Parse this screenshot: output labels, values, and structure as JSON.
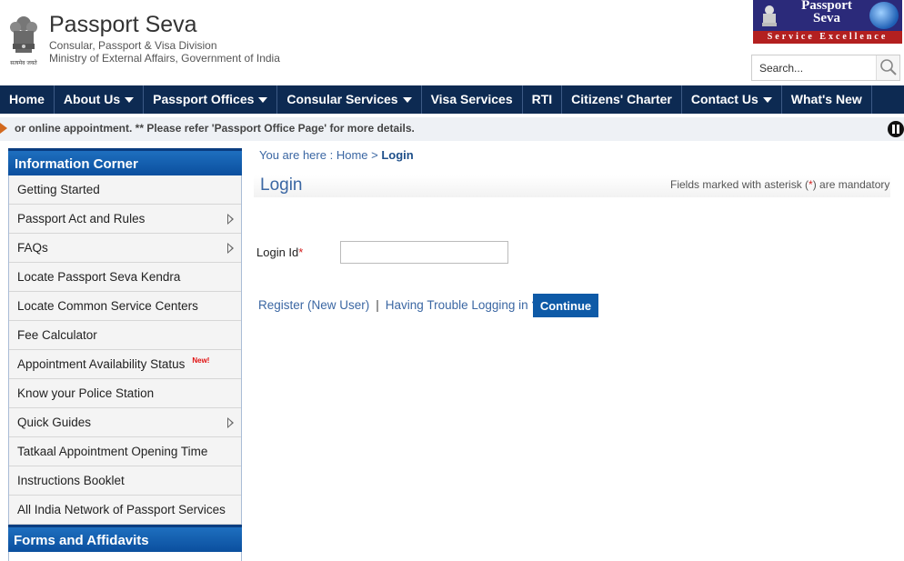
{
  "header": {
    "title": "Passport Seva",
    "subtitle1": "Consular, Passport & Visa Division",
    "subtitle2": "Ministry of External Affairs, Government of India",
    "logo_title": "Passport Seva",
    "logo_strip": "Service Excellence",
    "emblem_motto": "सत्यमेव जयते"
  },
  "search": {
    "placeholder": "Search..."
  },
  "nav": {
    "items": [
      {
        "label": "Home",
        "dropdown": false
      },
      {
        "label": "About Us",
        "dropdown": true
      },
      {
        "label": "Passport Offices",
        "dropdown": true
      },
      {
        "label": "Consular Services",
        "dropdown": true
      },
      {
        "label": "Visa Services",
        "dropdown": false
      },
      {
        "label": "RTI",
        "dropdown": false
      },
      {
        "label": "Citizens' Charter",
        "dropdown": false
      },
      {
        "label": "Contact Us",
        "dropdown": true
      },
      {
        "label": "What's New",
        "dropdown": false
      }
    ]
  },
  "marquee": {
    "text": "or online appointment. ** Please refer 'Passport Office Page' for more details."
  },
  "sidebar": {
    "heading": "Information Corner",
    "items": [
      {
        "label": "Getting Started",
        "submenu": false
      },
      {
        "label": "Passport Act and Rules",
        "submenu": true
      },
      {
        "label": "FAQs",
        "submenu": true
      },
      {
        "label": "Locate Passport Seva Kendra",
        "submenu": false
      },
      {
        "label": "Locate Common Service Centers",
        "submenu": false
      },
      {
        "label": "Fee Calculator",
        "submenu": false
      },
      {
        "label": "Appointment Availability Status",
        "submenu": false,
        "badge": "New!"
      },
      {
        "label": "Know your Police Station",
        "submenu": false
      },
      {
        "label": "Quick Guides",
        "submenu": true
      },
      {
        "label": "Tatkaal Appointment Opening Time",
        "submenu": false
      },
      {
        "label": "Instructions Booklet",
        "submenu": false
      },
      {
        "label": "All India Network of Passport Services",
        "submenu": false
      }
    ],
    "heading2": "Forms and Affidavits"
  },
  "breadcrumb": {
    "prefix": "You are here :",
    "home": "Home",
    "sep": ">",
    "current": "Login"
  },
  "main": {
    "title": "Login",
    "mandatory_pre": "Fields marked with asterisk (",
    "mandatory_ast": "*",
    "mandatory_post": ") are mandatory",
    "login_label": "Login Id",
    "login_ast": "*",
    "login_value": "",
    "register_link": "Register (New User)",
    "link_sep": "|",
    "trouble_link": "Having Trouble Logging in ?",
    "continue_label": "Continue"
  },
  "colors": {
    "nav_bg": "#0d2a52",
    "sidebar_head": "#0b4f9e",
    "link": "#3b67a3",
    "button": "#0e5aa7"
  }
}
